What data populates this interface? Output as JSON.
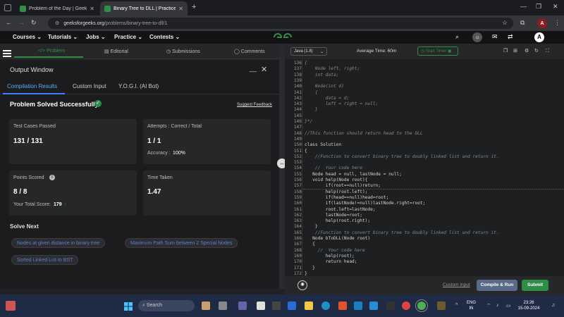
{
  "browser": {
    "tabs": [
      {
        "title": "Problem of the Day | GeeksforG",
        "active": false
      },
      {
        "title": "Binary Tree to DLL | Practice | G",
        "active": true
      }
    ],
    "url_host": "geeksforgeeks.org",
    "url_path": "/problems/binary-tree-to-dll/1"
  },
  "nav": {
    "items": [
      "Courses",
      "Tutorials",
      "Jobs",
      "Practice",
      "Contests"
    ],
    "avatar_letter": "A"
  },
  "problem_tabs": [
    "Problem",
    "Editorial",
    "Submissions",
    "Comments"
  ],
  "output": {
    "title": "Output Window",
    "tabs": [
      "Compilation Results",
      "Custom Input",
      "Y.O.G.I. (AI Bot)"
    ],
    "status": "Problem Solved Successfully",
    "feedback_link": "Suggest Feedback",
    "test_cases_label": "Test Cases Passed",
    "test_cases_value": "131 / 131",
    "attempts_label": "Attempts : Correct / Total",
    "attempts_value": "1 / 1",
    "accuracy_label": "Accuracy :",
    "accuracy_value": "100%",
    "points_label": "Points Scored",
    "points_value": "8 / 8",
    "total_score_label": "Your Total Score:",
    "total_score_value": "179",
    "time_label": "Time Taken",
    "time_value": "1.47",
    "solve_next_label": "Solve Next",
    "solve_next": [
      "Nodes at given distance in binary tree",
      "Maximum Path Sum between 2 Special Nodes",
      "Sorted Linked List to BST"
    ]
  },
  "editor": {
    "language": "Java (1.8)",
    "avg_time": "Average Time: 60m",
    "timer_label": "Start Timer",
    "lines": [
      {
        "n": "136",
        "t": "{",
        "c": "#8a8a8a"
      },
      {
        "n": "137",
        "t": "    Node left, right;",
        "c": "#8a8a8a"
      },
      {
        "n": "138",
        "t": "    int data;",
        "c": "#8a8a8a"
      },
      {
        "n": "139",
        "t": "",
        "c": "#8a8a8a"
      },
      {
        "n": "140",
        "t": "    Node(int d)",
        "c": "#8a8a8a"
      },
      {
        "n": "141",
        "t": "    {",
        "c": "#8a8a8a"
      },
      {
        "n": "142",
        "t": "        data = d;",
        "c": "#8a8a8a"
      },
      {
        "n": "143",
        "t": "        left = right = null;",
        "c": "#8a8a8a"
      },
      {
        "n": "144",
        "t": "    }",
        "c": "#8a8a8a"
      },
      {
        "n": "145",
        "t": "",
        "c": "#8a8a8a"
      },
      {
        "n": "146",
        "t": "}*/",
        "c": "#8a8a8a"
      },
      {
        "n": "147",
        "t": "",
        "c": "#8a8a8a"
      },
      {
        "n": "148",
        "t": "//This function should return head to the DLL",
        "c": "#8a8a8a"
      },
      {
        "n": "149",
        "t": "",
        "c": "#d4d4d4"
      },
      {
        "n": "150",
        "t": "class Solution",
        "c": "#d4d4d4"
      },
      {
        "n": "151",
        "t": "{",
        "c": "#d4d4d4"
      },
      {
        "n": "152",
        "t": "    //Function to convert binary tree to doubly linked list and return it.",
        "c": "#7a8a9a"
      },
      {
        "n": "153",
        "t": "",
        "c": "#d4d4d4"
      },
      {
        "n": "154",
        "t": "    //  Your code here",
        "c": "#7a8a9a"
      },
      {
        "n": "155",
        "t": "   Node head = null, lastNode = null;",
        "c": "#d4d4d4"
      },
      {
        "n": "156",
        "t": "   void help(Node root){",
        "c": "#d4d4d4"
      },
      {
        "n": "157",
        "t": "        if(root==null)return;",
        "c": "#d4d4d4"
      },
      {
        "n": "158",
        "t": "        help(root.left);",
        "c": "#d4d4d4"
      },
      {
        "n": "159",
        "t": "        if(head==null)head=root;",
        "c": "#d4d4d4"
      },
      {
        "n": "160",
        "t": "        if(lastNode!=null)lastNode.right=root;",
        "c": "#d4d4d4"
      },
      {
        "n": "161",
        "t": "        root.left=lastNode;",
        "c": "#d4d4d4"
      },
      {
        "n": "162",
        "t": "        lastNode=root;",
        "c": "#d4d4d4"
      },
      {
        "n": "163",
        "t": "        help(root.right);",
        "c": "#d4d4d4"
      },
      {
        "n": "164",
        "t": "    }",
        "c": "#d4d4d4"
      },
      {
        "n": "165",
        "t": "    //Function to convert binary tree to doubly linked list and return it.",
        "c": "#7a8a9a"
      },
      {
        "n": "166",
        "t": "   Node bToDLL(Node root)",
        "c": "#d4d4d4"
      },
      {
        "n": "167",
        "t": "   {",
        "c": "#d4d4d4"
      },
      {
        "n": "168",
        "t": "     //  Your code here",
        "c": "#7a8a9a"
      },
      {
        "n": "169",
        "t": "        help(root);",
        "c": "#d4d4d4"
      },
      {
        "n": "170",
        "t": "        return head;",
        "c": "#d4d4d4"
      },
      {
        "n": "171",
        "t": "   }",
        "c": "#d4d4d4"
      },
      {
        "n": "172",
        "t": "}",
        "c": "#d4d4d4"
      }
    ],
    "custom_input_label": "Custom Input",
    "compile_label": "Compile & Run",
    "submit_label": "Submit"
  },
  "taskbar": {
    "search_placeholder": "Search",
    "lang_top": "ENG",
    "lang_bottom": "IN",
    "time": "23:26",
    "date": "15-09-2024"
  },
  "colors": {
    "brand_green": "#2f8d46",
    "link_blue": "#5e7fcb"
  }
}
